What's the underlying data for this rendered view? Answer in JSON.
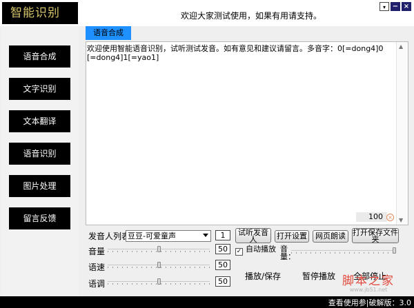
{
  "app": {
    "logo": "智能识别",
    "welcome": "欢迎大家测试使用，如果有用请支持。"
  },
  "window_buttons": {
    "skin_icon": "skin-icon",
    "minimize": "−",
    "close": "×"
  },
  "sidebar": {
    "items": [
      {
        "label": "语音合成"
      },
      {
        "label": "文字识别"
      },
      {
        "label": "文本翻译"
      },
      {
        "label": "语音识别"
      },
      {
        "label": "图片处理"
      },
      {
        "label": "留言反馈"
      }
    ]
  },
  "main": {
    "active_tab": "语音合成",
    "text_content": "欢迎使用智能语音识别，试听测试发音。如有意见和建议请留言。多音字：0[=dong4]0\n[=dong4]1[=yao1]",
    "char_count": "100",
    "speaker_label": "发音人列表",
    "speaker_selected": "豆豆-可爱童声",
    "speaker_count": "1",
    "volume_label": "音量",
    "volume_value": "50",
    "speed_label": "语速",
    "speed_value": "50",
    "pitch_label": "语调",
    "pitch_value": "50",
    "auto_play_label": "自动播放",
    "sound_label": "音量：",
    "buttons": {
      "preview": "试听发音人",
      "open_settings": "打开设置",
      "web_read": "网页朗读",
      "open_save_folder": "打开保存文件夹",
      "play_save": "播放/保存",
      "pause": "暂停播放",
      "stop_all": "全部停止"
    }
  },
  "statusbar": {
    "text": "查看使用参|破解版：3.0"
  },
  "watermark": {
    "main": "脚本之家",
    "sub": "www.jb51.net"
  },
  "colors": {
    "tab_active": "#1e90ff",
    "nav_bg": "#000000",
    "logo_text": "#d7c66a",
    "watermark": "#e0493c"
  }
}
